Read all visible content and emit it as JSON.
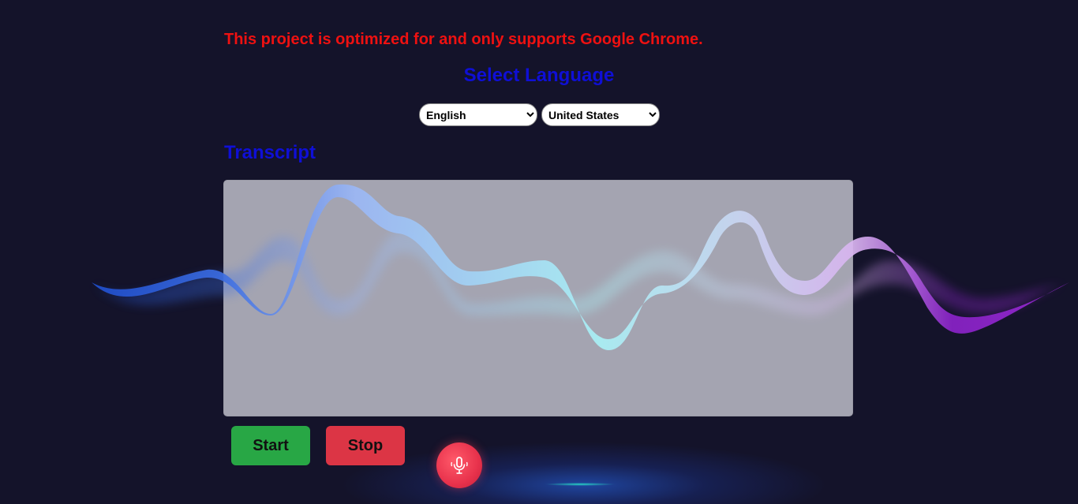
{
  "notice": "This project is optimized for and only supports Google Chrome.",
  "language_section": {
    "heading": "Select Language",
    "language_select": {
      "selected": "English"
    },
    "country_select": {
      "selected": "United States"
    }
  },
  "transcript_section": {
    "heading": "Transcript",
    "text": ""
  },
  "controls": {
    "start_label": "Start",
    "stop_label": "Stop",
    "mic_icon": "microphone-icon"
  },
  "colors": {
    "background": "#14132a",
    "notice": "#ee1111",
    "heading": "#0f0fd6",
    "start": "#28a745",
    "stop": "#dc3545",
    "mic": "#e8324c"
  }
}
